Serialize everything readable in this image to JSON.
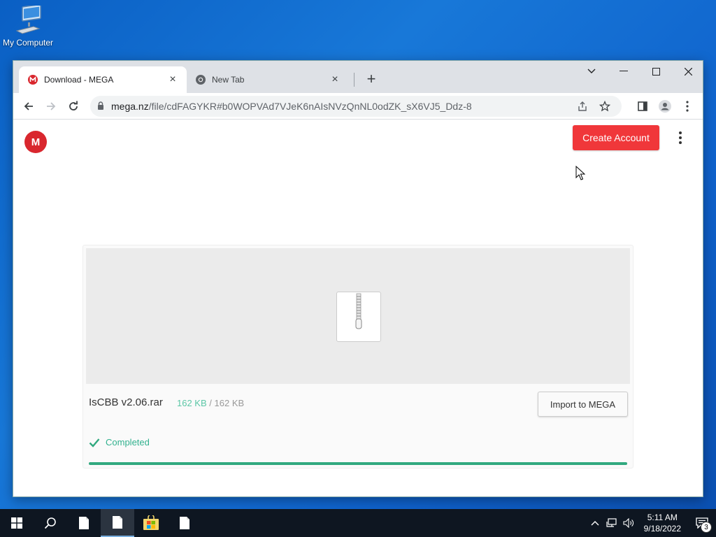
{
  "desktop": {
    "icon_label": "My Computer"
  },
  "browser": {
    "tabs": [
      {
        "title": "Download - MEGA",
        "favicon": "mega-icon",
        "active": true
      },
      {
        "title": "New Tab",
        "favicon": "chrome-icon",
        "active": false
      }
    ],
    "address": {
      "domain": "mega.nz",
      "path": "/file/cdFAGYKR#b0WOPVAd7VJeK6nAIsNVzQnNL0odZK_sX6VJ5_Ddz-8"
    }
  },
  "page": {
    "logo_letter": "M",
    "create_account_label": "Create Account",
    "file": {
      "name": "IsCBB v2.06.rar",
      "downloaded": "162 KB",
      "separator": "/",
      "total": "162 KB"
    },
    "import_label": "Import to MEGA",
    "status_text": "Completed",
    "progress_percent": 100,
    "colors": {
      "brand_red": "#d9272e",
      "create_button": "#f0373a",
      "success_green": "#31a97f"
    }
  },
  "taskbar": {
    "time": "5:11 AM",
    "date": "9/18/2022",
    "notification_count": "3"
  }
}
